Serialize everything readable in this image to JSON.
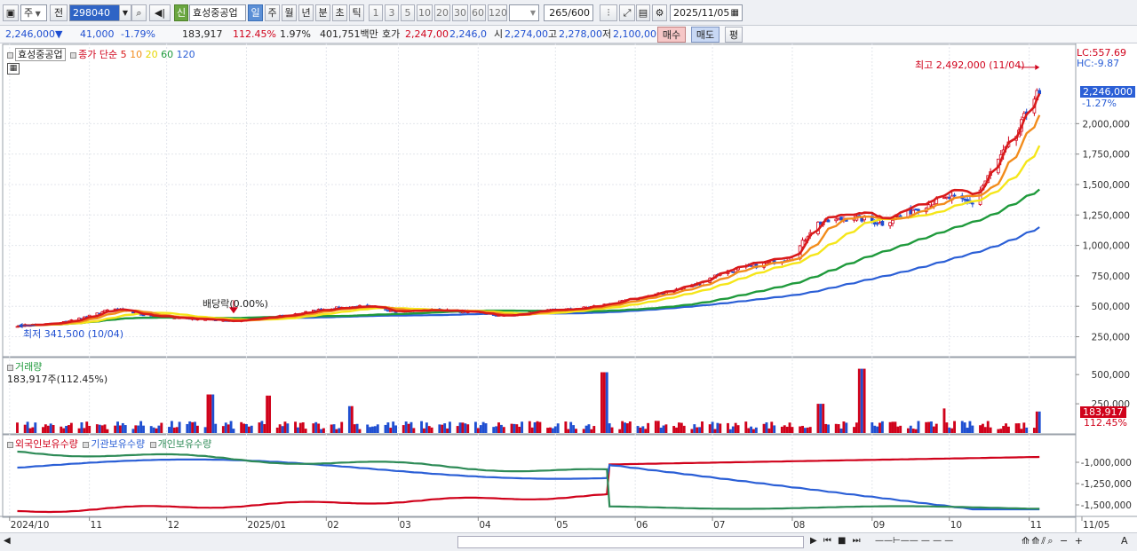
{
  "toolbar": {
    "market": "주",
    "prev_btn": "전",
    "code": "298040",
    "badge": "신",
    "stock_name": "효성중공업",
    "periods": [
      "일",
      "주",
      "월",
      "년",
      "분",
      "초",
      "틱"
    ],
    "active_period": "일",
    "intervals": [
      "1",
      "3",
      "5",
      "10",
      "20",
      "30",
      "60",
      "120"
    ],
    "count": "265",
    "count_total": "/600",
    "date": "2025/11/05"
  },
  "quote": {
    "price": "2,246,000",
    "change_arrow": "▼",
    "change": "41,000",
    "change_pct": "-1.79%",
    "volume": "183,917",
    "volume_ratio": "112.45%",
    "turnover": "1.97%",
    "amount": "401,751백만",
    "bid_label": "호가",
    "bid": "2,247,00",
    "ask": "2,246,0",
    "open_label": "시",
    "open": "2,274,00",
    "high_label": "고",
    "high": "2,278,00",
    "low_label": "저",
    "low": "2,100,00",
    "buy_btn": "매수",
    "sell_btn": "매도",
    "eval_btn": "평"
  },
  "colors": {
    "up": "#d0021b",
    "down": "#1f4fd1",
    "ma5": "#d91a1a",
    "ma10": "#f28c1c",
    "ma20": "#f5e61a",
    "ma60": "#1f9a3c",
    "ma120": "#2b5fd6"
  },
  "chart_data": [
    {
      "type": "line",
      "pane": "price",
      "legend": {
        "name": "효성중공업",
        "series_label": "종가 단순",
        "periods": [
          "5",
          "10",
          "20",
          "60",
          "120"
        ]
      },
      "x_ticks": [
        "2024/10",
        "11",
        "12",
        "2025/01",
        "02",
        "03",
        "04",
        "05",
        "06",
        "07",
        "08",
        "09",
        "10",
        "11",
        "11/05"
      ],
      "y_ticks": [
        "2,000,000",
        "1,750,000",
        "1,500,000",
        "1,250,000",
        "1,000,000",
        "750,000",
        "500,000",
        "250,000"
      ],
      "ylim": [
        130000,
        2600000
      ],
      "current_price_label": "2,246,000",
      "current_change_label": "-1.27%",
      "lc_label": "LC:557.69",
      "hc_label": "HC:-9.87",
      "annotations": {
        "high": "최고 2,492,000 (11/04)",
        "low": "최저 341,500 (10/04)",
        "dividend": "배당락(0.00%)"
      },
      "close_anchors": [
        [
          "2024/10/04",
          341500
        ],
        [
          "2024/10/20",
          360000
        ],
        [
          "2024/11/01",
          420000
        ],
        [
          "2024/11/10",
          480000
        ],
        [
          "2024/11/25",
          420000
        ],
        [
          "2024/12/10",
          400000
        ],
        [
          "2024/12/27",
          380000
        ],
        [
          "2025/01/15",
          420000
        ],
        [
          "2025/02/01",
          480000
        ],
        [
          "2025/02/15",
          500000
        ],
        [
          "2025/03/01",
          460000
        ],
        [
          "2025/03/15",
          470000
        ],
        [
          "2025/04/01",
          450000
        ],
        [
          "2025/04/10",
          420000
        ],
        [
          "2025/04/25",
          460000
        ],
        [
          "2025/05/10",
          480000
        ],
        [
          "2025/05/25",
          530000
        ],
        [
          "2025/06/10",
          600000
        ],
        [
          "2025/06/25",
          680000
        ],
        [
          "2025/07/05",
          780000
        ],
        [
          "2025/07/20",
          840000
        ],
        [
          "2025/08/01",
          900000
        ],
        [
          "2025/08/10",
          1180000
        ],
        [
          "2025/08/25",
          1230000
        ],
        [
          "2025/09/05",
          1180000
        ],
        [
          "2025/09/20",
          1320000
        ],
        [
          "2025/10/01",
          1390000
        ],
        [
          "2025/10/10",
          1350000
        ],
        [
          "2025/10/20",
          1700000
        ],
        [
          "2025/10/27",
          1900000
        ],
        [
          "2025/11/04",
          2287000
        ],
        [
          "2025/11/05",
          2246000
        ]
      ],
      "ma_end_values": {
        "ma5": 2246000,
        "ma10": 2070000,
        "ma20": 1820000,
        "ma60": 1460000,
        "ma120": 1150000
      }
    },
    {
      "type": "bar",
      "pane": "volume",
      "title": "거래량",
      "subtitle": "183,917주(112.45%)",
      "y_ticks": [
        "500,000",
        "250,000"
      ],
      "current_label": "183,917",
      "current_ratio": "112.45%",
      "typical": 80000,
      "spikes": [
        [
          "2024/12/18",
          330000
        ],
        [
          "2025/01/10",
          320000
        ],
        [
          "2025/02/10",
          230000
        ],
        [
          "2025/05/20",
          520000
        ],
        [
          "2025/08/28",
          550000
        ],
        [
          "2025/08/12",
          250000
        ],
        [
          "2025/09/28",
          210000
        ],
        [
          "2025/11/05",
          183917
        ]
      ]
    },
    {
      "type": "line",
      "pane": "holdings",
      "series": [
        {
          "name": "외국인보유수량",
          "color": "#d0021b"
        },
        {
          "name": "기관보유수량",
          "color": "#2b5fd6"
        },
        {
          "name": "개인보유수량",
          "color": "#2e8b57"
        }
      ],
      "y_ticks": [
        "-1,000,000",
        "-1,250,000",
        "-1,500,000"
      ]
    }
  ]
}
